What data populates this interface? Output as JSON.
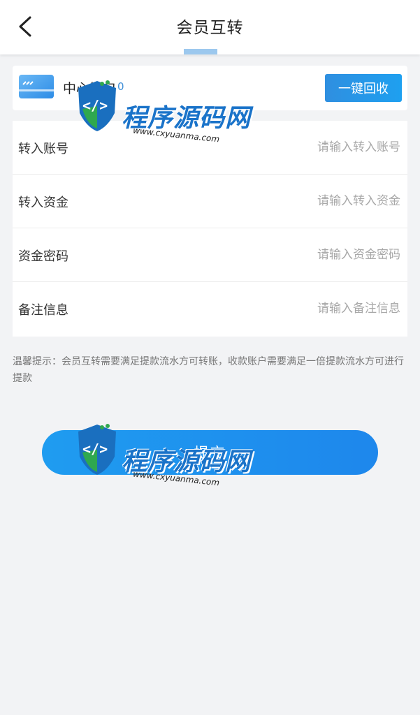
{
  "header": {
    "title": "会员互转"
  },
  "wallet": {
    "name": "中心钱包",
    "balance": "0",
    "recall_label": "一键回收"
  },
  "form": {
    "rows": [
      {
        "label": "转入账号",
        "placeholder": "请输入转入账号"
      },
      {
        "label": "转入资金",
        "placeholder": "请输入转入资金"
      },
      {
        "label": "资金密码",
        "placeholder": "请输入资金密码"
      },
      {
        "label": "备注信息",
        "placeholder": "请输入备注信息"
      }
    ]
  },
  "tip": "温馨提示：会员互转需要满足提款流水方可转账，收款账户需要满足一倍提款流水方可进行提款",
  "submit_label": "提交",
  "watermark": {
    "brand": "程序源码网",
    "url": "www.cxyuanma.com"
  },
  "colors": {
    "accent": "#1e90ee",
    "background": "#f2f3f5",
    "balance": "#3f8fd8"
  }
}
